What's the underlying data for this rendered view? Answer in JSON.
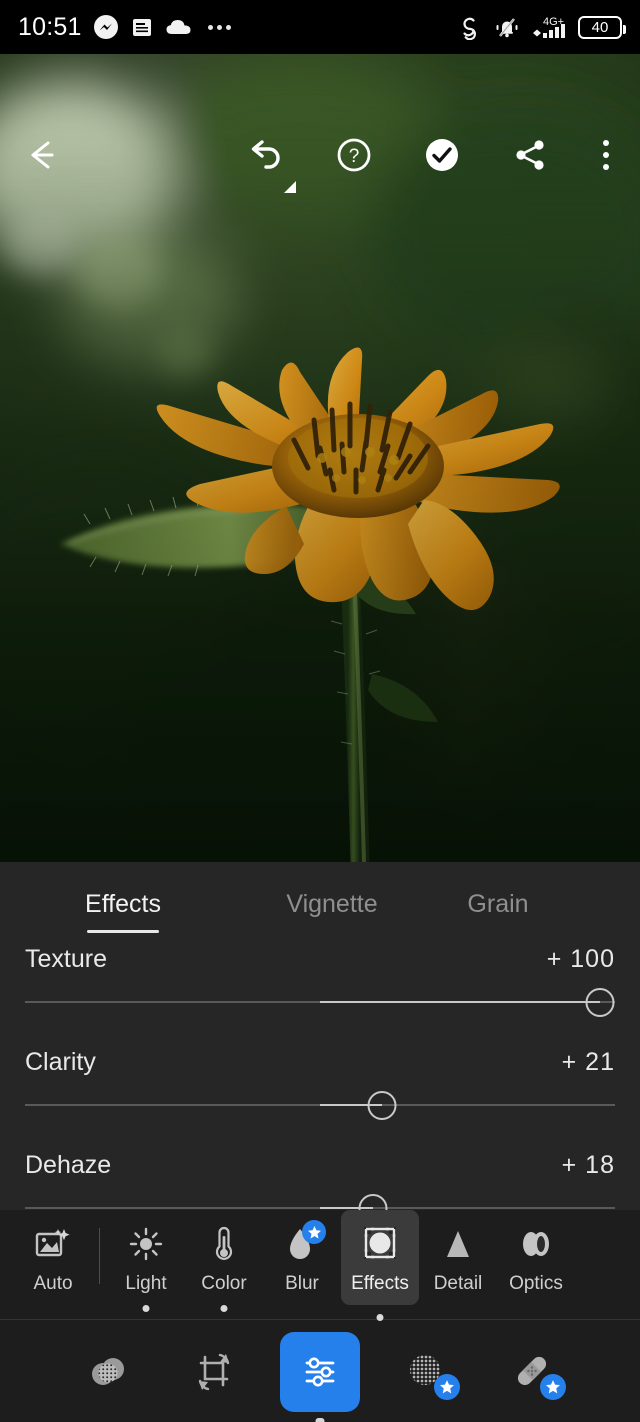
{
  "statusbar": {
    "time": "10:51",
    "battery_level": "40",
    "network": "4G+",
    "left_icons": [
      "messenger-icon",
      "news-article-icon",
      "cloud-icon",
      "more-notifications-icon"
    ],
    "right_icons": [
      "sync-spiral-icon",
      "ringer-muted-icon",
      "signal-bars-icon",
      "battery-icon"
    ]
  },
  "toolbar": {
    "back": "back-arrow-icon",
    "undo": "undo-icon",
    "help": "help-circle-icon",
    "done": "check-circle-icon",
    "share": "share-icon",
    "overflow": "more-vertical-icon"
  },
  "panel": {
    "tabs": [
      {
        "label": "Effects",
        "active": true
      },
      {
        "label": "Vignette",
        "active": false
      },
      {
        "label": "Grain",
        "active": false
      }
    ],
    "sliders": [
      {
        "name": "Texture",
        "value": "+ 100",
        "percent": 100
      },
      {
        "name": "Clarity",
        "value": "+ 21",
        "percent": 21
      },
      {
        "name": "Dehaze",
        "value": "+ 18",
        "percent": 18
      }
    ]
  },
  "tools": [
    {
      "label": "Auto",
      "icon": "auto-enhance-icon",
      "selected": false,
      "dot": false,
      "premium": false
    },
    {
      "label": "Light",
      "icon": "sun-icon",
      "selected": false,
      "dot": true,
      "premium": false
    },
    {
      "label": "Color",
      "icon": "thermometer-icon",
      "selected": false,
      "dot": true,
      "premium": false
    },
    {
      "label": "Blur",
      "icon": "droplet-icon",
      "selected": false,
      "dot": false,
      "premium": true
    },
    {
      "label": "Effects",
      "icon": "effects-square-icon",
      "selected": true,
      "dot": true,
      "premium": false
    },
    {
      "label": "Detail",
      "icon": "triangle-icon",
      "selected": false,
      "dot": false,
      "premium": false
    },
    {
      "label": "Optics",
      "icon": "lens-icon",
      "selected": false,
      "dot": false,
      "premium": false
    }
  ],
  "bottom_nav": [
    {
      "name": "presets-button",
      "icon": "presets-circles-icon",
      "active": false,
      "badge": false
    },
    {
      "name": "crop-button",
      "icon": "crop-rotate-icon",
      "active": false,
      "badge": false
    },
    {
      "name": "edit-button",
      "icon": "sliders-icon",
      "active": true,
      "badge": false
    },
    {
      "name": "masking-button",
      "icon": "masking-dotted-circle-icon",
      "active": false,
      "badge": true
    },
    {
      "name": "healing-button",
      "icon": "healing-bandage-icon",
      "active": false,
      "badge": true
    }
  ],
  "colors": {
    "accent_blue": "#2680eb",
    "panel_bg": "#262626",
    "bar_bg": "#1d1d1d",
    "selected_tool_bg": "#3b3b3b",
    "track": "#595959",
    "track_fill": "#c9c9c9"
  },
  "photo": {
    "subject": "orange-flower-photo"
  }
}
